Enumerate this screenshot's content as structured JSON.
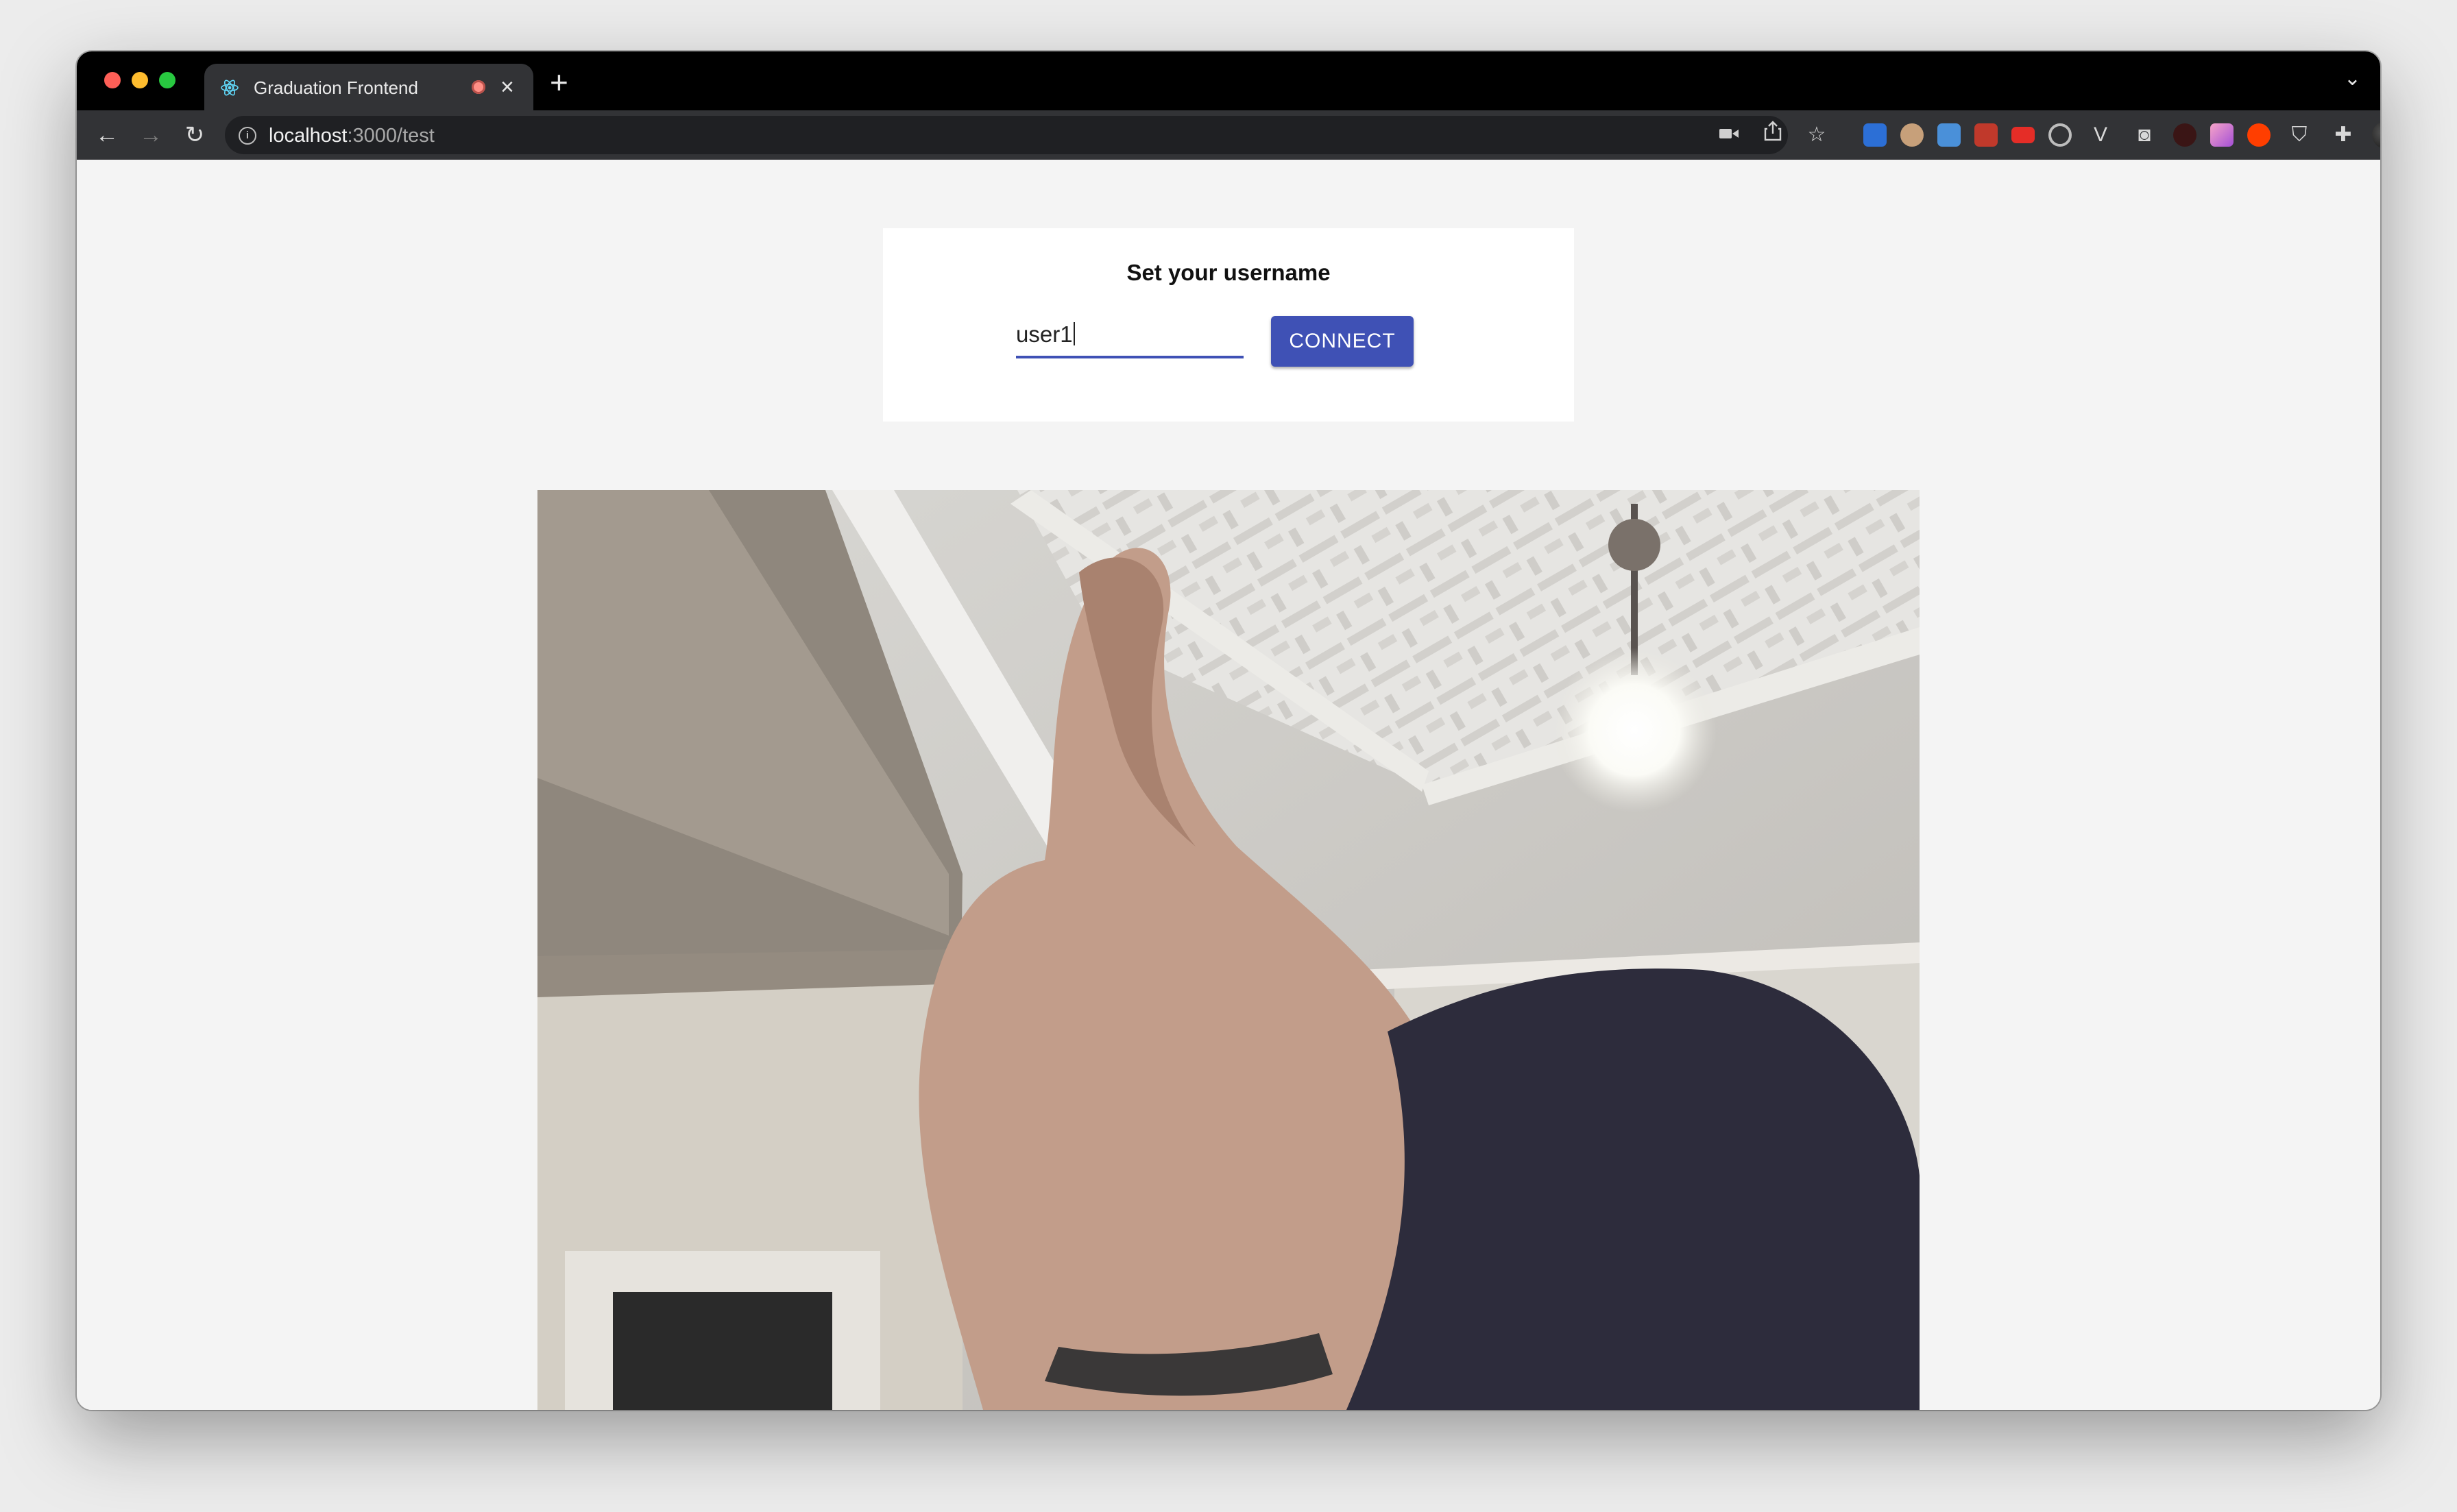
{
  "browser": {
    "tab": {
      "title": "Graduation Frontend",
      "close_glyph": "×"
    },
    "new_tab_glyph": "+",
    "tab_list_glyph": "⌄",
    "url": {
      "host": "localhost",
      "path": ":3000/test"
    },
    "omnibox_icons": [
      "camera-icon",
      "share-icon",
      "bookmark-star-icon"
    ],
    "extensions": [
      {
        "name": "translate-extension-icon",
        "color": "#2c6fd6"
      },
      {
        "name": "face-extension-icon",
        "color": "#c7a07a"
      },
      {
        "name": "window-extension-icon",
        "color": "#4a90d9"
      },
      {
        "name": "gift-extension-icon",
        "color": "#c0392b"
      },
      {
        "name": "youtube-extension-icon",
        "color": "#e52d27"
      },
      {
        "name": "target-extension-icon",
        "color": "#bdbdbd"
      },
      {
        "name": "vue-extension-icon",
        "color": "#bdbdbd"
      },
      {
        "name": "camera-extension-icon",
        "color": "#cfcfcf"
      },
      {
        "name": "slash-extension-icon",
        "color": "#6b1f1f"
      },
      {
        "name": "gradient-extension-icon",
        "color": "#e05fa3"
      },
      {
        "name": "svelte-extension-icon",
        "color": "#ff3e00"
      },
      {
        "name": "shield-extension-icon",
        "color": "#e0e0e0"
      }
    ]
  },
  "page": {
    "title": "Set your username",
    "username_value": "user1",
    "connect_label": "CONNECT"
  },
  "colors": {
    "accent": "#3f51b5",
    "page_background": "#f4f4f4",
    "toolbar": "#323336",
    "tabstrip": "#000000"
  }
}
